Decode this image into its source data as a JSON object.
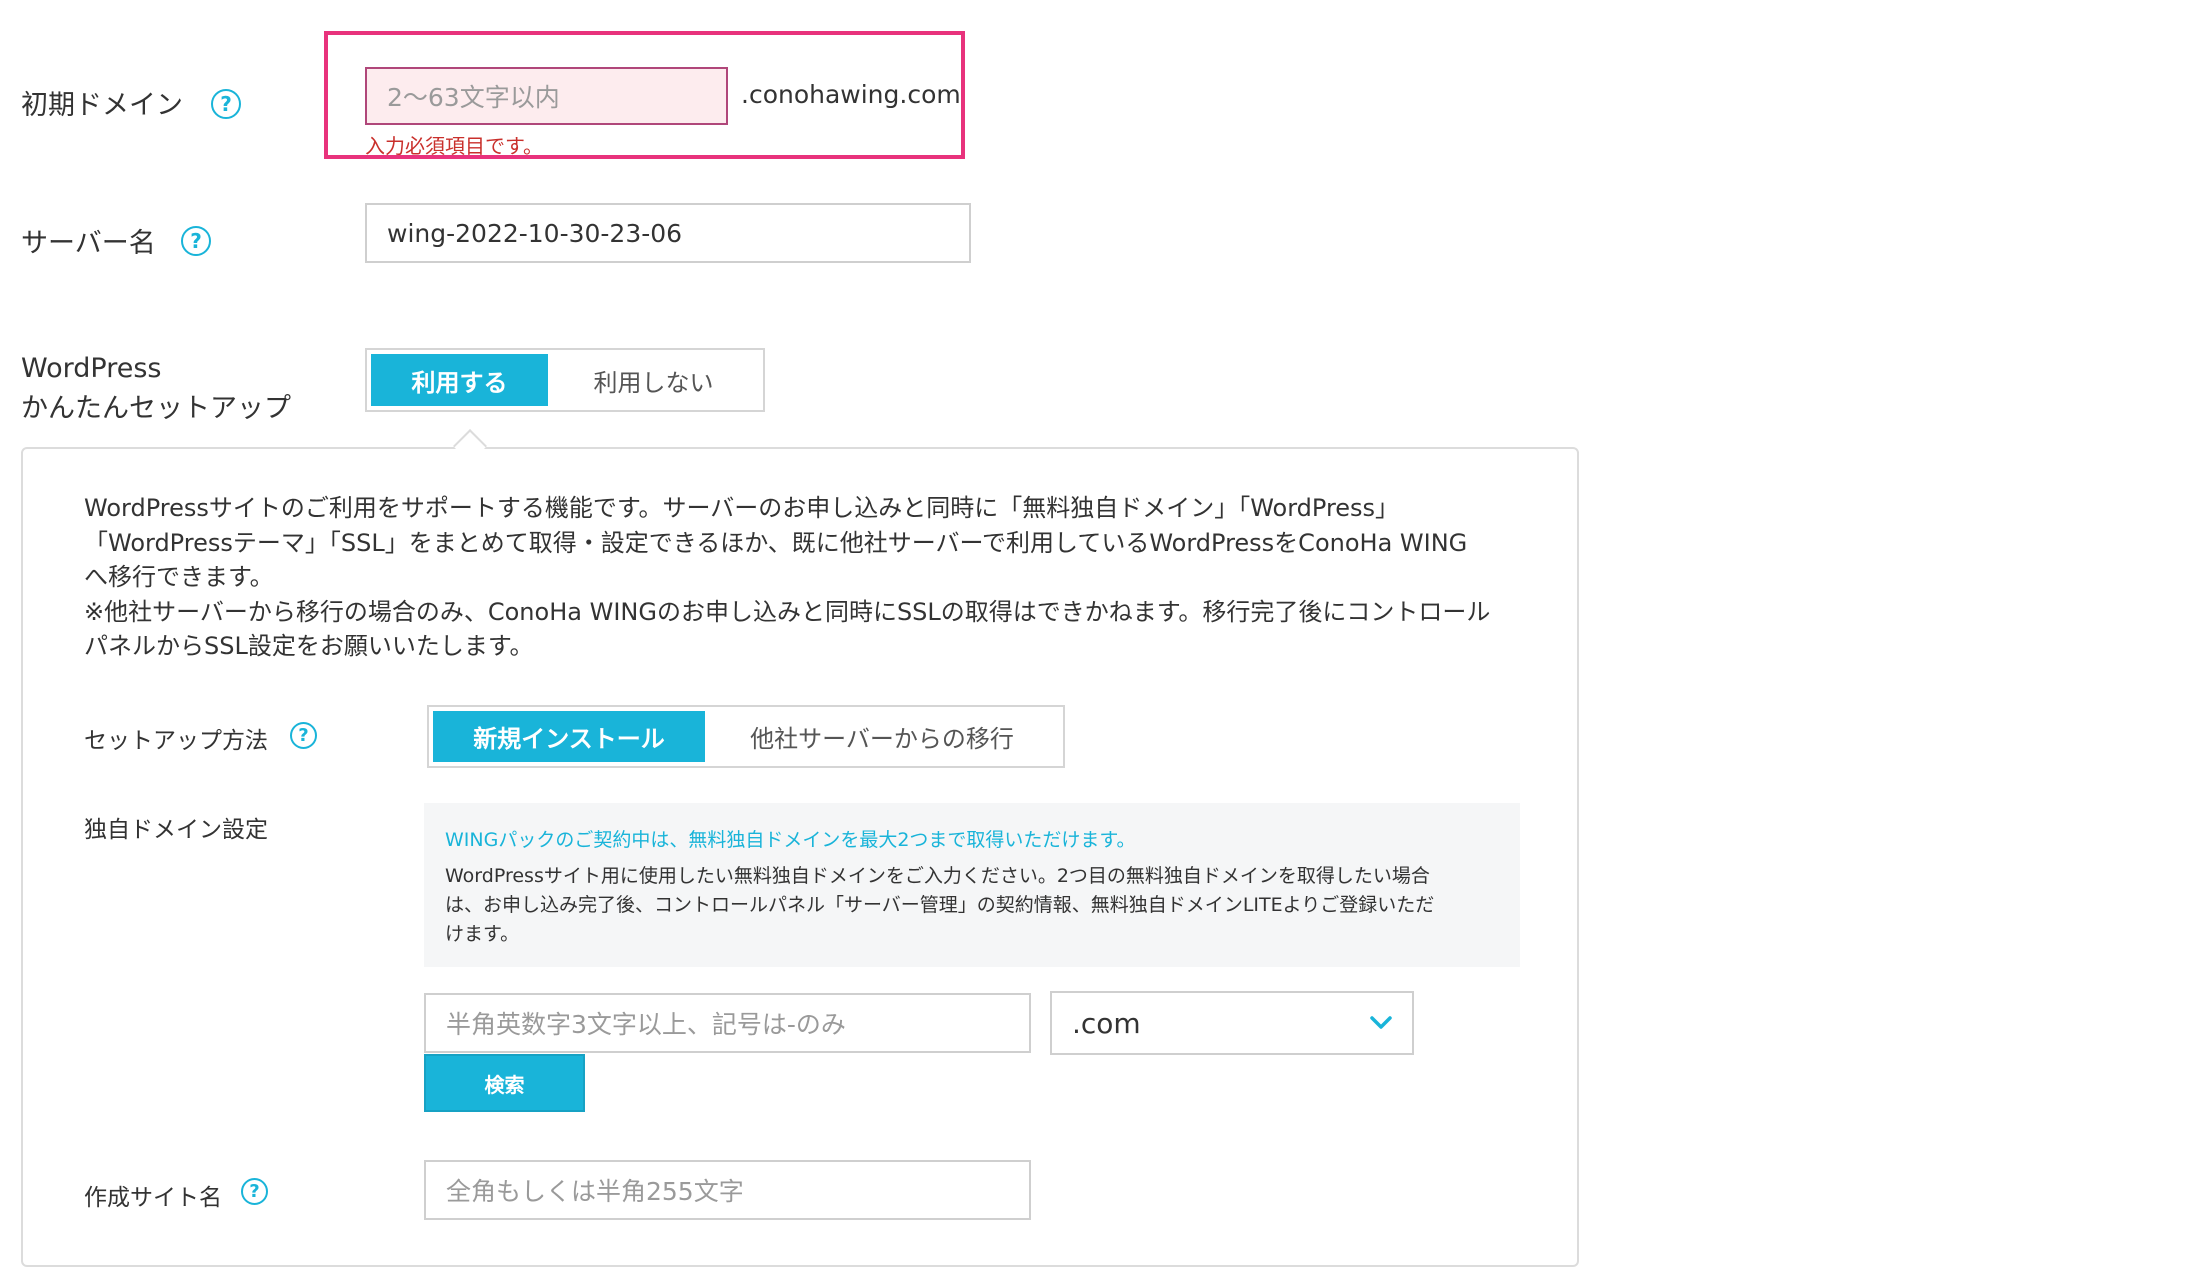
{
  "initial_domain": {
    "label": "初期ドメイン",
    "placeholder": "2〜63文字以内",
    "suffix": ".conohawing.com",
    "error": "入力必須項目です。"
  },
  "server_name": {
    "label": "サーバー名",
    "value": "wing-2022-10-30-23-06"
  },
  "wordpress_setup": {
    "label_line1": "WordPress",
    "label_line2": "かんたんセットアップ",
    "options": [
      "利用する",
      "利用しない"
    ],
    "selected": "利用する"
  },
  "panel": {
    "description": "WordPressサイトのご利用をサポートする機能です。サーバーのお申し込みと同時に「無料独自ドメイン」「WordPress」\n「WordPressテーマ」「SSL」をまとめて取得・設定できるほか、既に他社サーバーで利用しているWordPressをConoHa WING\nへ移行できます。\n※他社サーバーから移行の場合のみ、ConoHa WINGのお申し込みと同時にSSLの取得はできかねます。移行完了後にコントロール\nパネルからSSL設定をお願いいたします。",
    "setup_method": {
      "label": "セットアップ方法",
      "options": [
        "新規インストール",
        "他社サーバーからの移行"
      ],
      "selected": "新規インストール"
    },
    "custom_domain": {
      "label": "独自ドメイン設定",
      "info_head": "WINGパックのご契約中は、無料独自ドメインを最大2つまで取得いただけます。",
      "info_body": "WordPressサイト用に使用したい無料独自ドメインをご入力ください。2つ目の無料独自ドメインを取得したい場合\nは、お申し込み完了後、コントロールパネル「サーバー管理」の契約情報、無料独自ドメインLITEよりご登録いただ\nけます。",
      "input_placeholder": "半角英数字3文字以上、記号は-のみ",
      "tld_selected": ".com",
      "search_label": "検索"
    },
    "site_name": {
      "label": "作成サイト名",
      "placeholder": "全角もしくは半角255文字"
    }
  },
  "colors": {
    "accent": "#19b4d9",
    "highlight_border": "#e8327c",
    "error_text": "#c9302c",
    "error_input_bg": "#fdecee",
    "error_input_border": "#b0477a"
  }
}
